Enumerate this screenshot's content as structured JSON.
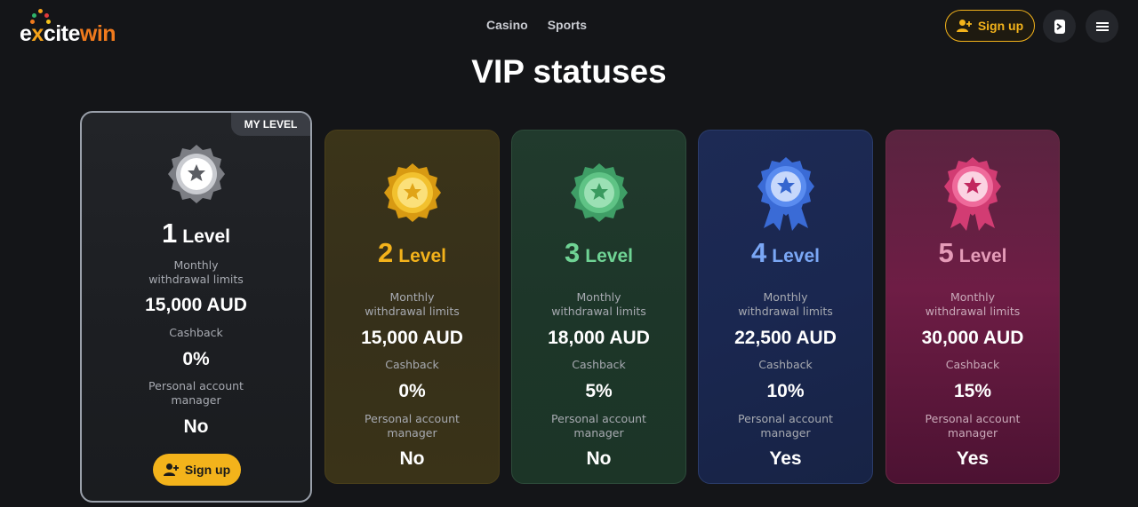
{
  "header": {
    "logo_text": "excitewin",
    "nav": [
      "Casino",
      "Sports"
    ],
    "signup_label": "Sign up"
  },
  "page": {
    "title": "VIP statuses"
  },
  "levels": [
    {
      "num": "1",
      "word": "Level",
      "color": "#ffffff",
      "badge_color": "#9a9ca2",
      "limits_label_1": "Monthly",
      "limits_label_2": "withdrawal limits",
      "limits": "15,000 AUD",
      "cashback_label": "Cashback",
      "cashback": "0%",
      "manager_label_1": "Personal account",
      "manager_label_2": "manager",
      "manager": "No",
      "my_level": "MY LEVEL",
      "signup_label": "Sign up"
    },
    {
      "num": "2",
      "word": "Level",
      "color": "#f3b21b",
      "badge_color": "#f2c12e",
      "limits_label_1": "Monthly",
      "limits_label_2": "withdrawal limits",
      "limits": "15,000 AUD",
      "cashback_label": "Cashback",
      "cashback": "0%",
      "manager_label_1": "Personal account",
      "manager_label_2": "manager",
      "manager": "No"
    },
    {
      "num": "3",
      "word": "Level",
      "color": "#6fd394",
      "badge_color": "#5fc385",
      "limits_label_1": "Monthly",
      "limits_label_2": "withdrawal limits",
      "limits": "18,000 AUD",
      "cashback_label": "Cashback",
      "cashback": "5%",
      "manager_label_1": "Personal account",
      "manager_label_2": "manager",
      "manager": "No"
    },
    {
      "num": "4",
      "word": "Level",
      "color": "#7aa7f5",
      "badge_color": "#4b7ee8",
      "limits_label_1": "Monthly",
      "limits_label_2": "withdrawal limits",
      "limits": "22,500 AUD",
      "cashback_label": "Cashback",
      "cashback": "10%",
      "manager_label_1": "Personal account",
      "manager_label_2": "manager",
      "manager": "Yes"
    },
    {
      "num": "5",
      "word": "Level",
      "color": "#e59bb8",
      "badge_color": "#e0407b",
      "limits_label_1": "Monthly",
      "limits_label_2": "withdrawal limits",
      "limits": "30,000 AUD",
      "cashback_label": "Cashback",
      "cashback": "15%",
      "manager_label_1": "Personal account",
      "manager_label_2": "manager",
      "manager": "Yes"
    }
  ]
}
